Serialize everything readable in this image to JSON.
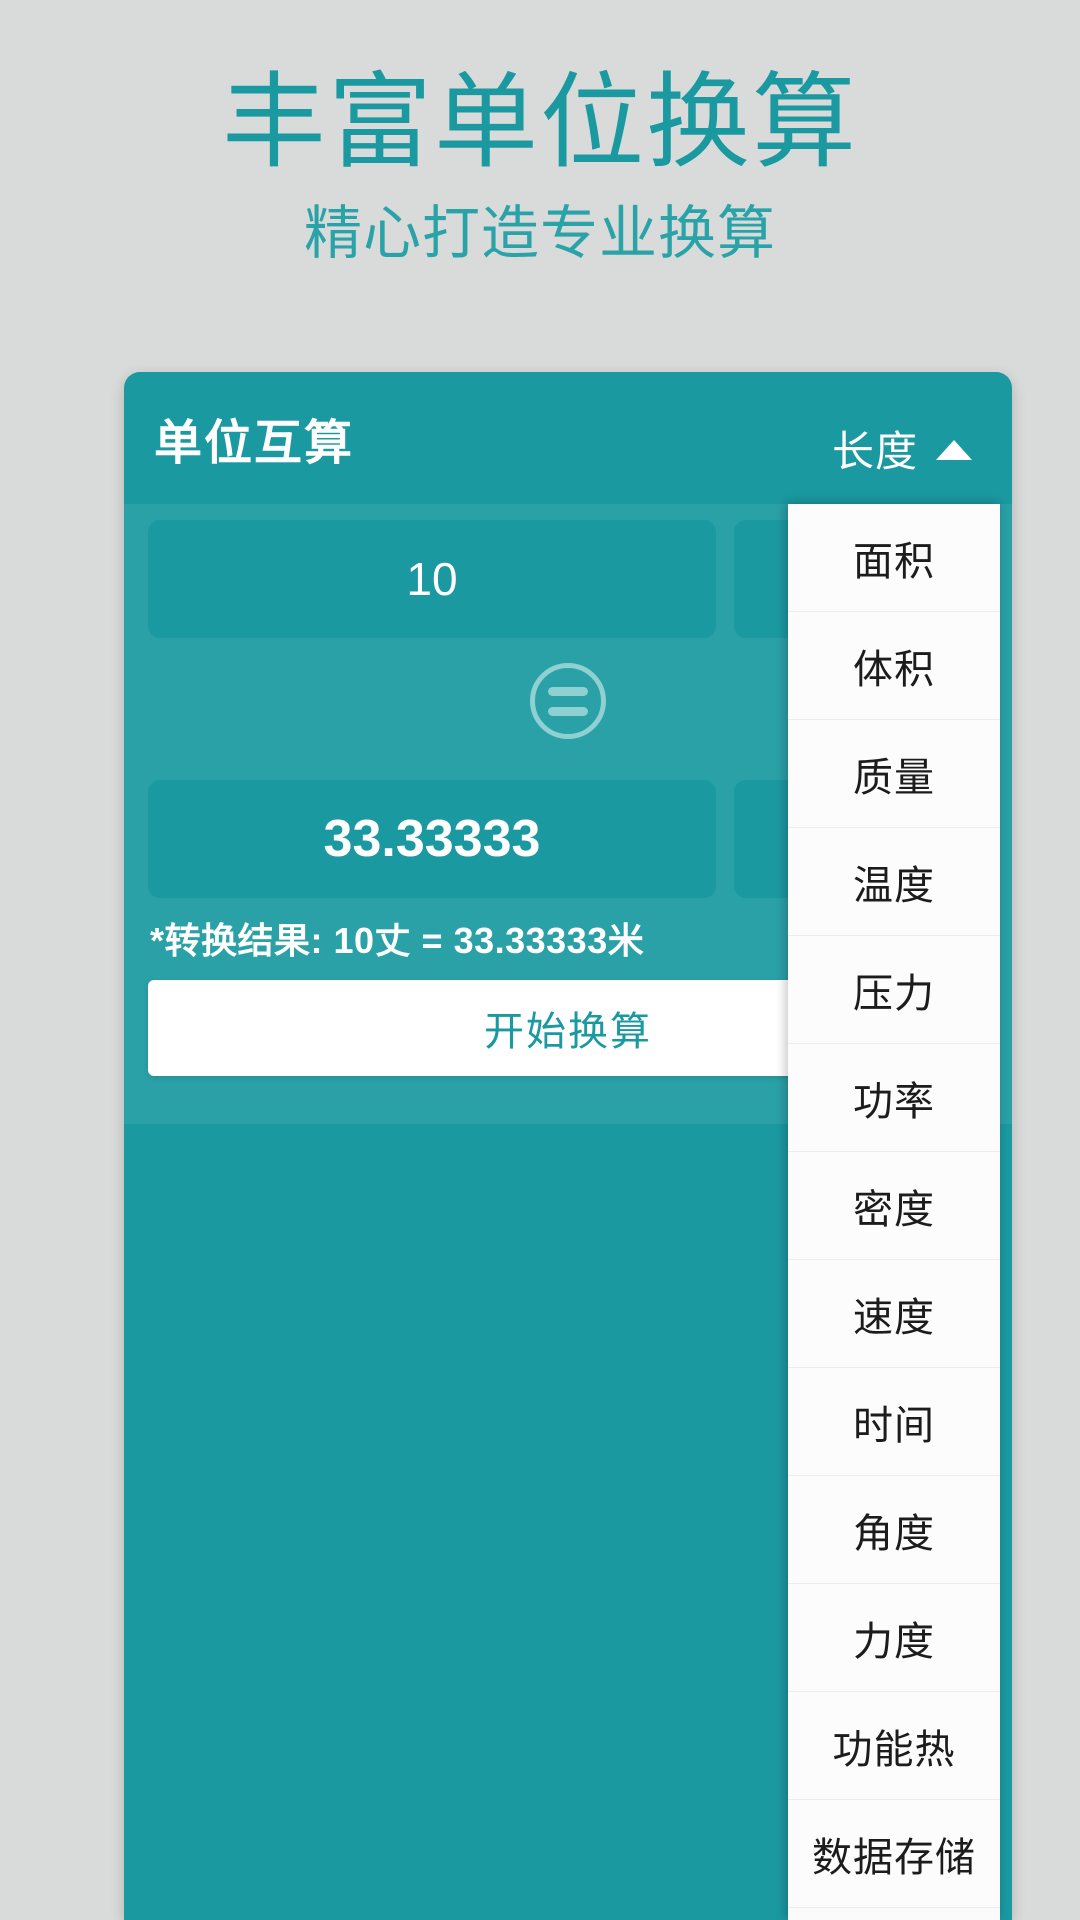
{
  "promo": {
    "title": "丰富单位换算",
    "subtitle": "精心打造专业换算",
    "accent_color": "#1a99a0",
    "background_color": "#d9dbdb"
  },
  "app": {
    "title": "单位互算",
    "brand_color": "#1b99a1",
    "panel_color": "#2aa1a7",
    "category_selector": {
      "selected": "长度",
      "caret": "chevron-up-icon"
    },
    "input_row": {
      "value": "10",
      "unit": ""
    },
    "equals_icon": "equals-circle-icon",
    "output_row": {
      "value": "33.33333",
      "unit": ""
    },
    "result_note": "*转换结果: 10丈 = 33.33333米",
    "convert_button": "开始换算"
  },
  "dropdown": {
    "items": [
      {
        "label": "面积"
      },
      {
        "label": "体积"
      },
      {
        "label": "质量"
      },
      {
        "label": "温度"
      },
      {
        "label": "压力"
      },
      {
        "label": "功率"
      },
      {
        "label": "密度"
      },
      {
        "label": "速度"
      },
      {
        "label": "时间"
      },
      {
        "label": "角度"
      },
      {
        "label": "力度"
      },
      {
        "label": "功能热"
      },
      {
        "label": "数据存储"
      }
    ]
  }
}
